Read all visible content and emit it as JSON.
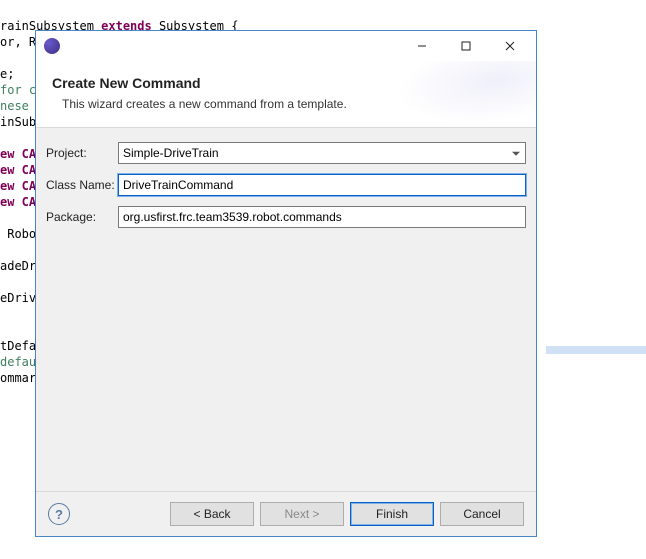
{
  "code": {
    "line1a": "rainSubsystem ",
    "line1b": "extends",
    "line1c": " Subsystem {",
    "line2": "or, RFMotor,RBMotor, LBMotor;",
    "line3": "e;",
    "line4": "for c",
    "line5": "nese",
    "line6": "inSub",
    "line7": "ew CA",
    "line8": "ew CA",
    "line9": "ew CA",
    "line10": "ew CA",
    "line11": " Robo",
    "line12": "adeDr",
    "line13": "eDriv",
    "line14": "tDefa",
    "line15": "defau",
    "line16": "ommar"
  },
  "dialog": {
    "title": "Create New Command",
    "subtitle": "This wizard creates a new command from a template.",
    "labels": {
      "project": "Project:",
      "class_name": "Class Name:",
      "package": "Package:"
    },
    "values": {
      "project": "Simple-DriveTrain",
      "class_name": "DriveTrainCommand",
      "package": "org.usfirst.frc.team3539.robot.commands"
    },
    "buttons": {
      "back": "< Back",
      "next": "Next >",
      "finish": "Finish",
      "cancel": "Cancel"
    },
    "help_glyph": "?"
  }
}
